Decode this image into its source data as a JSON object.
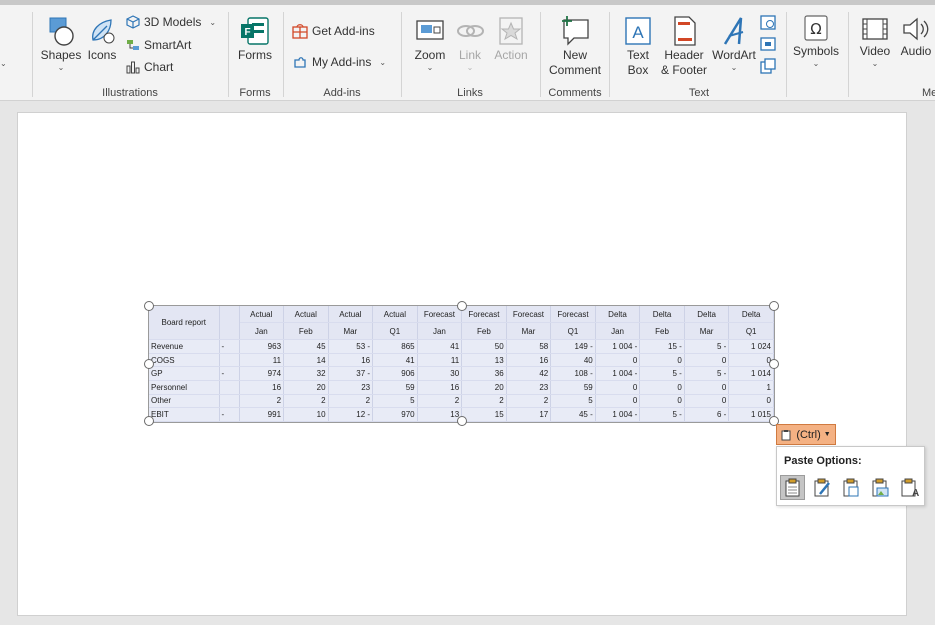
{
  "ribbon": {
    "groups": {
      "illustrations": "Illustrations",
      "forms": "Forms",
      "addins": "Add-ins",
      "links": "Links",
      "comments": "Comments",
      "text": "Text",
      "media": "Medi"
    },
    "buttons": {
      "shapes": "Shapes",
      "icons": "Icons",
      "models3d": "3D Models",
      "smartart": "SmartArt",
      "chart": "Chart",
      "forms": "Forms",
      "get_addins": "Get Add-ins",
      "my_addins": "My Add-ins",
      "zoom": "Zoom",
      "link": "Link",
      "action": "Action",
      "new_comment_1": "New",
      "new_comment_2": "Comment",
      "text_box_1": "Text",
      "text_box_2": "Box",
      "header_footer_1": "Header",
      "header_footer_2": "& Footer",
      "wordart": "WordArt",
      "symbols": "Symbols",
      "video": "Video",
      "audio": "Audio"
    }
  },
  "table": {
    "header_row1": [
      "Actual",
      "Actual",
      "Actual",
      "Actual",
      "Forecast",
      "Forecast",
      "Forecast",
      "Forecast",
      "Delta",
      "Delta",
      "Delta",
      "Delta"
    ],
    "header_row2": [
      "Jan",
      "Feb",
      "Mar",
      "Q1",
      "Jan",
      "Feb",
      "Mar",
      "Q1",
      "Jan",
      "Feb",
      "Mar",
      "Q1"
    ],
    "title": "Board report",
    "rows": [
      {
        "label": "Revenue",
        "dash": "-",
        "cells": [
          "963",
          "45",
          "53 -",
          "865",
          "41",
          "50",
          "58",
          "149 -",
          "1 004 -",
          "15 -",
          "5 -",
          "1 024"
        ]
      },
      {
        "label": "COGS",
        "dash": "",
        "cells": [
          "11",
          "14",
          "16",
          "41",
          "11",
          "13",
          "16",
          "40",
          "0",
          "0",
          "0",
          "0"
        ]
      },
      {
        "label": "GP",
        "dash": "-",
        "cells": [
          "974",
          "32",
          "37 -",
          "906",
          "30",
          "36",
          "42",
          "108 -",
          "1 004 -",
          "5 -",
          "5 -",
          "1 014"
        ]
      },
      {
        "label": "Personnel",
        "dash": "",
        "cells": [
          "16",
          "20",
          "23",
          "59",
          "16",
          "20",
          "23",
          "59",
          "0",
          "0",
          "0",
          "1"
        ]
      },
      {
        "label": "Other",
        "dash": "",
        "cells": [
          "2",
          "2",
          "2",
          "5",
          "2",
          "2",
          "2",
          "5",
          "0",
          "0",
          "0",
          "0"
        ]
      },
      {
        "label": "EBIT",
        "dash": "-",
        "cells": [
          "991",
          "10",
          "12 -",
          "970",
          "13",
          "15",
          "17",
          "45 -",
          "1 004 -",
          "5 -",
          "6 -",
          "1 015"
        ]
      }
    ]
  },
  "paste": {
    "ctrl_label": "(Ctrl)",
    "title": "Paste Options:"
  }
}
